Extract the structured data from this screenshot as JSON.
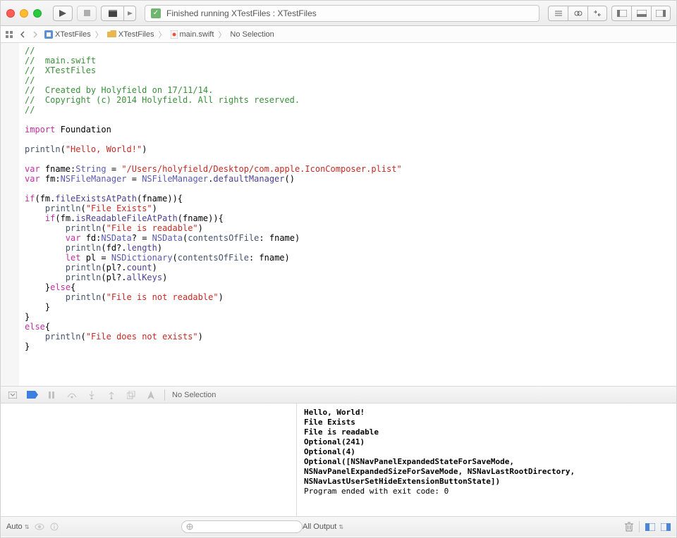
{
  "toolbar": {
    "status_text": "Finished running XTestFiles : XTestFiles"
  },
  "jumpbar": {
    "project": "XTestFiles",
    "folder": "XTestFiles",
    "file": "main.swift",
    "selection": "No Selection"
  },
  "code": {
    "c1": "//",
    "c2": "//  main.swift",
    "c3": "//  XTestFiles",
    "c4": "//",
    "c5": "//  Created by Holyfield on 17/11/14.",
    "c6": "//  Copyright (c) 2014 Holyfield. All rights reserved.",
    "c7": "//",
    "kw_import": "import",
    "foundation": " Foundation",
    "fn_println": "println",
    "str_hello": "\"Hello, World!\"",
    "kw_var": "var",
    "fname_decl": " fname:",
    "ty_string": "String",
    "eq": " = ",
    "str_path": "\"/Users/holyfield/Desktop/com.apple.IconComposer.plist\"",
    "fm_decl": " fm:",
    "ty_nsfm": "NSFileManager",
    "fm_eq": " = ",
    "nsfm2": "NSFileManager",
    "dot": ".",
    "defmgr": "defaultManager",
    "parens": "()",
    "kw_if": "if",
    "lp": "(",
    "rp": ")",
    "fm": "fm",
    "fileExists": "fileExistsAtPath",
    "fnameRef": "fname",
    "brace_o": "{",
    "brace_c": "}",
    "str_exists": "\"File Exists\"",
    "isReadable": "isReadableFileAtPath",
    "str_readable": "\"File is readable\"",
    "fd_decl": " fd:",
    "ty_nsdata": "NSData",
    "qmark": "?",
    "nsdata2": "NSData",
    "contentsOf": "contentsOfFile",
    "colon_sp": ": ",
    "fdref": "fd?",
    "length": "length",
    "kw_let": "let",
    "pl_decl": " pl = ",
    "ty_nsdict": "NSDictionary",
    "plref": "pl?",
    "count": "count",
    "allkeys": "allKeys",
    "kw_else": "else",
    "str_notread": "\"File is not readable\"",
    "str_notexist": "\"File does not exists\""
  },
  "debugbar": {
    "selection": "No Selection"
  },
  "console": {
    "l1": "Hello, World!",
    "l2": "File Exists",
    "l3": "File is readable",
    "l4": "Optional(241)",
    "l5": "Optional(4)",
    "l6": "Optional([NSNavPanelExpandedStateForSaveMode, NSNavPanelExpandedSizeForSaveMode, NSNavLastRootDirectory, NSNavLastUserSetHideExtensionButtonState])",
    "l7": "Program ended with exit code: 0"
  },
  "bottom": {
    "auto": "Auto",
    "all_output": "All Output"
  }
}
